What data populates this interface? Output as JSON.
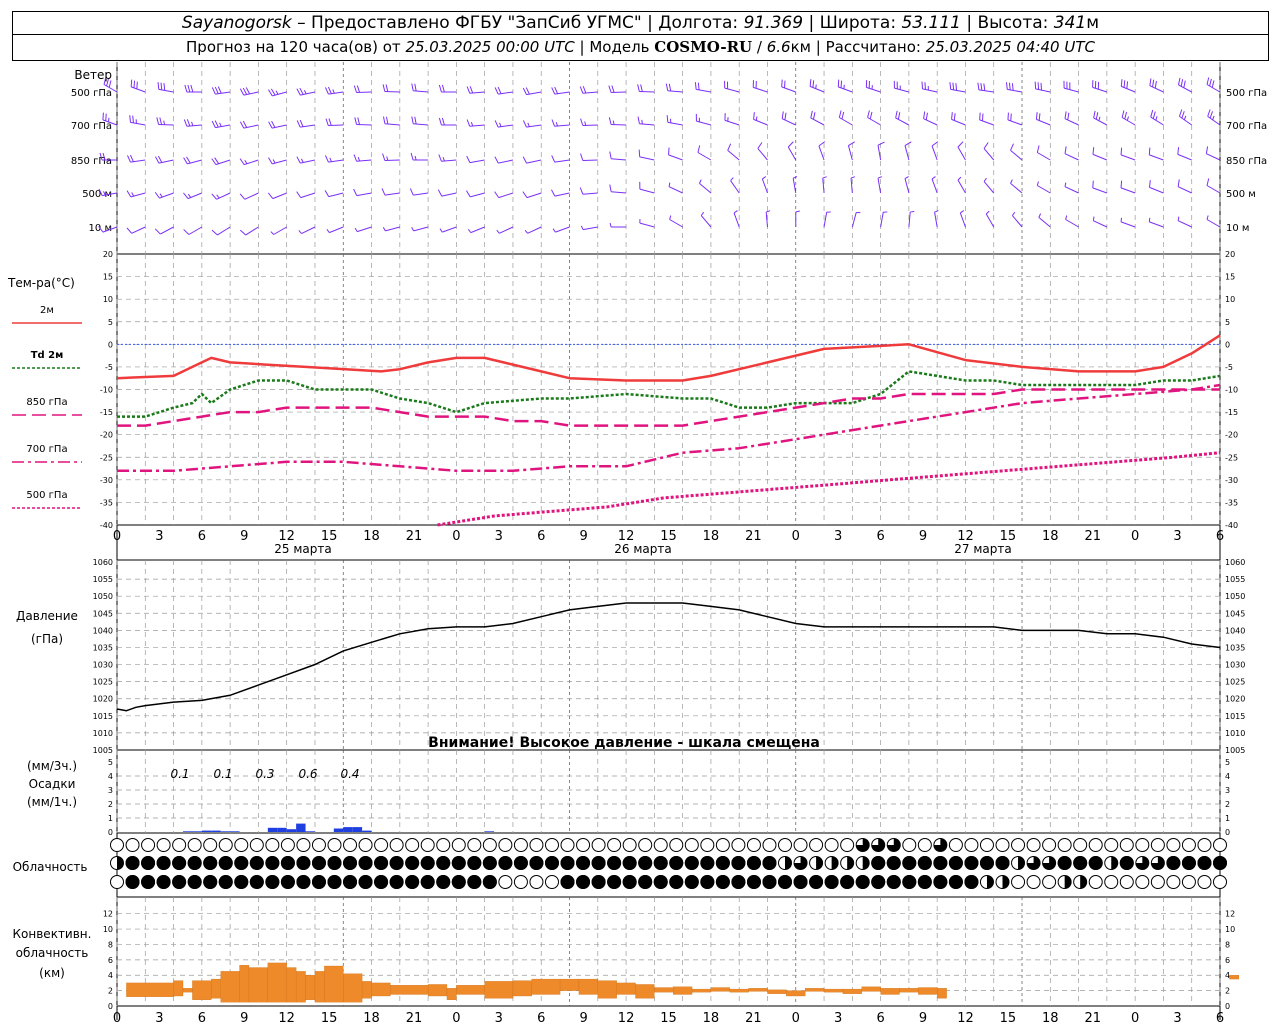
{
  "header": {
    "station": "Sayanogorsk",
    "dash": "–",
    "provider": "Предоставлено ФГБУ \"ЗапСиб УГМС\"",
    "lon_label": "Долгота:",
    "lon": "91.369",
    "lat_label": "Широта:",
    "lat": "53.111",
    "alt_label": "Высота:",
    "alt": "341",
    "alt_unit": "м",
    "fc_prefix": "Прогноз на 120 часа(ов) от",
    "fc_start": "25.03.2025 00:00 UTC",
    "model_label": "Модель",
    "model": "COSMO-RU",
    "model_res": "6.6",
    "model_res_unit": "км",
    "calc_label": "Рассчитано:",
    "calc_time": "25.03.2025 04:40 UTC"
  },
  "colors": {
    "wind": "#7b2ff7",
    "t2m": "#ef3b3b",
    "td2m": "#1a7a1a",
    "t850": "#e0147f",
    "t700": "#e0147f",
    "t500": "#e0147f",
    "zero": "#3355ff",
    "pressure": "#000000",
    "precip": "#1f3fe0",
    "convective": "#ef8a2a",
    "grid": "#9a9a9a"
  },
  "time_axis": {
    "tick_labels": [
      "0",
      "3",
      "6",
      "9",
      "12",
      "15",
      "18",
      "21",
      "0",
      "3",
      "6",
      "9",
      "12",
      "15",
      "18",
      "21",
      "0",
      "3",
      "6",
      "9",
      "12",
      "15",
      "18",
      "21",
      "0",
      "3",
      "6"
    ],
    "day_labels": [
      "25 марта",
      "26 марта",
      "27 марта"
    ]
  },
  "wind": {
    "title": "Ветер",
    "levels": [
      "500 гПа",
      "700 гПа",
      "850 гПа",
      "500 м",
      "10 м"
    ]
  },
  "chart_data": [
    {
      "type": "line",
      "title": "Тем-ра(°C)",
      "x_unit": "hours from 25.03.2025 00:00 UTC",
      "ylim": [
        -40,
        20
      ],
      "yticks": [
        "20",
        "15",
        "10",
        "5",
        "0",
        "-5",
        "-10",
        "-15",
        "-20",
        "-25",
        "-30",
        "-35",
        "-40"
      ],
      "series": [
        {
          "name": "2м",
          "x": [
            0,
            6,
            8,
            10,
            12,
            16,
            20,
            28,
            30,
            33,
            36,
            39,
            45,
            48,
            54,
            60,
            63,
            69,
            75,
            84,
            90,
            96,
            102,
            105,
            108,
            111,
            114,
            117
          ],
          "values": [
            -7.5,
            -7,
            -5,
            -3,
            -4,
            -4.5,
            -5,
            -6,
            -5.5,
            -4,
            -3,
            -3,
            -6,
            -7.5,
            -8,
            -8,
            -7,
            -4,
            -1,
            0,
            -3.5,
            -5,
            -6,
            -6,
            -6,
            -5,
            -2,
            2
          ]
        },
        {
          "name": "Td 2м",
          "x": [
            0,
            3,
            6,
            8,
            9,
            10,
            12,
            15,
            18,
            21,
            24,
            27,
            30,
            33,
            36,
            39,
            45,
            48,
            54,
            60,
            63,
            66,
            69,
            72,
            75,
            78,
            81,
            84,
            87,
            90,
            93,
            96,
            99,
            102,
            105,
            108,
            111,
            114,
            117
          ],
          "values": [
            -16,
            -16,
            -14,
            -13,
            -11,
            -13,
            -10,
            -8,
            -8,
            -10,
            -10,
            -10,
            -12,
            -13,
            -15,
            -13,
            -12,
            -12,
            -11,
            -12,
            -12,
            -14,
            -14,
            -13,
            -13,
            -13,
            -11,
            -6,
            -7,
            -8,
            -8,
            -9,
            -9,
            -9,
            -9,
            -9,
            -8,
            -8,
            -7
          ]
        },
        {
          "name": "850 гПа",
          "x": [
            0,
            3,
            6,
            9,
            12,
            15,
            18,
            21,
            24,
            27,
            30,
            33,
            36,
            39,
            42,
            45,
            48,
            51,
            54,
            57,
            60,
            63,
            66,
            69,
            72,
            75,
            78,
            81,
            84,
            87,
            90,
            93,
            96,
            99,
            102,
            105,
            108,
            111,
            114,
            117
          ],
          "values": [
            -18,
            -18,
            -17,
            -16,
            -15,
            -15,
            -14,
            -14,
            -14,
            -14,
            -15,
            -16,
            -16,
            -16,
            -17,
            -17,
            -18,
            -18,
            -18,
            -18,
            -18,
            -17,
            -16,
            -15,
            -14,
            -13,
            -12,
            -12,
            -11,
            -11,
            -11,
            -11,
            -10,
            -10,
            -10,
            -10,
            -10,
            -10,
            -10,
            -10
          ]
        },
        {
          "name": "700 гПа",
          "x": [
            0,
            6,
            12,
            18,
            24,
            30,
            36,
            42,
            48,
            54,
            60,
            66,
            72,
            78,
            84,
            90,
            96,
            102,
            108,
            114,
            117
          ],
          "values": [
            -28,
            -28,
            -27,
            -26,
            -26,
            -27,
            -28,
            -28,
            -27,
            -27,
            -24,
            -23,
            -21,
            -19,
            -17,
            -15,
            -13,
            -12,
            -11,
            -10,
            -9
          ]
        },
        {
          "name": "500 гПа",
          "x": [
            34,
            40,
            46,
            52,
            58,
            64,
            70,
            76,
            82,
            88,
            94,
            100,
            106,
            112,
            117
          ],
          "values": [
            -40,
            -38,
            -37,
            -36,
            -34,
            -33,
            -32,
            -31,
            -30,
            -29,
            -28,
            -27,
            -26,
            -25,
            -24
          ]
        }
      ]
    },
    {
      "type": "line",
      "title": "Давление",
      "unit": "(гПа)",
      "note": "Внимание! Высокое давление - шкала смещена",
      "ylim": [
        1005,
        1060
      ],
      "yticks": [
        "1060",
        "1055",
        "1050",
        "1045",
        "1040",
        "1035",
        "1030",
        "1025",
        "1020",
        "1015",
        "1010",
        "1005"
      ],
      "series": [
        {
          "name": "Давление",
          "x": [
            0,
            1,
            2,
            3,
            6,
            9,
            12,
            15,
            18,
            21,
            24,
            27,
            30,
            33,
            36,
            39,
            42,
            45,
            48,
            51,
            54,
            57,
            60,
            63,
            66,
            69,
            72,
            75,
            78,
            81,
            84,
            87,
            90,
            93,
            96,
            99,
            102,
            105,
            108,
            111,
            114,
            117
          ],
          "values": [
            1017,
            1016.5,
            1017.5,
            1018,
            1019,
            1019.5,
            1021,
            1024,
            1027,
            1030,
            1034,
            1036.5,
            1039,
            1040.5,
            1041,
            1041,
            1042,
            1044,
            1046,
            1047,
            1048,
            1048,
            1048,
            1047,
            1046,
            1044,
            1042,
            1041,
            1041,
            1041,
            1041,
            1041,
            1041,
            1041,
            1040,
            1040,
            1040,
            1039,
            1039,
            1038,
            1036,
            1035
          ]
        }
      ]
    },
    {
      "type": "bar",
      "title": "Осадки",
      "unit_3h": "(мм/3ч.)",
      "unit_1h": "(мм/1ч.)",
      "ylim": [
        0,
        5
      ],
      "yticks": [
        "5",
        "4",
        "3",
        "2",
        "1",
        "0"
      ],
      "sum_labels": [
        "0.1",
        "0.1",
        "0.3",
        "0.6",
        "0.4"
      ],
      "x": [
        6,
        7,
        8,
        9,
        10,
        11,
        12,
        13,
        14,
        15,
        16,
        17,
        18,
        19,
        20,
        21,
        22,
        23,
        24,
        25,
        26,
        27,
        28,
        29,
        30,
        31,
        32,
        33,
        34,
        35,
        36,
        37,
        38,
        39,
        40
      ],
      "values": [
        0,
        0,
        0.05,
        0.05,
        0.1,
        0.1,
        0.05,
        0.05,
        0,
        0,
        0,
        0.3,
        0.3,
        0.2,
        0.6,
        0.05,
        0,
        0,
        0.25,
        0.35,
        0.35,
        0.1,
        0,
        0,
        0,
        0,
        0,
        0,
        0,
        0,
        0,
        0,
        0,
        0,
        0.05
      ]
    },
    {
      "type": "table",
      "title": "Облачность",
      "rows": [
        "upper",
        "middle",
        "lower"
      ],
      "legend": "0 = clear, 1 = 1/4, 2 = 1/2, 3 = 3/4, 4 = overcast",
      "upper": "000000000000000000000000000000000000000000000000000000000000000000000000000000000003333330003000000000000000000000000000000000",
      "middle": "244444444444444444444444444444444444444444444444444444444444444444444444444444444444442333232322244444444444444444442333344444422443333444424444",
      "lower": "044444444444444444444444444444444444444444444444000002044444444444444444444444444444444444444444444444444444420220000002222000000000000000000"
    },
    {
      "type": "bar",
      "title": "Конвективн. облачность",
      "unit": "(км)",
      "ylim": [
        0,
        14
      ],
      "yticks": [
        "12",
        "10",
        "8",
        "6",
        "4",
        "2",
        "0"
      ],
      "bars": [
        {
          "x0": 1,
          "x1": 6,
          "lo": 1.2,
          "hi": 3.0
        },
        {
          "x0": 6,
          "x1": 7,
          "lo": 1.3,
          "hi": 3.3
        },
        {
          "x0": 7,
          "x1": 8,
          "lo": 1.8,
          "hi": 2.3
        },
        {
          "x0": 8,
          "x1": 10,
          "lo": 0.8,
          "hi": 3.3
        },
        {
          "x0": 10,
          "x1": 11,
          "lo": 1.0,
          "hi": 3.5
        },
        {
          "x0": 11,
          "x1": 13,
          "lo": 0.5,
          "hi": 4.5
        },
        {
          "x0": 13,
          "x1": 14,
          "lo": 0.5,
          "hi": 5.3
        },
        {
          "x0": 14,
          "x1": 16,
          "lo": 0.5,
          "hi": 5.0
        },
        {
          "x0": 16,
          "x1": 18,
          "lo": 0.5,
          "hi": 5.6
        },
        {
          "x0": 18,
          "x1": 19,
          "lo": 0.5,
          "hi": 5.0
        },
        {
          "x0": 19,
          "x1": 20,
          "lo": 0.5,
          "hi": 4.5
        },
        {
          "x0": 20,
          "x1": 21,
          "lo": 0.8,
          "hi": 4.0
        },
        {
          "x0": 21,
          "x1": 22,
          "lo": 0.5,
          "hi": 4.5
        },
        {
          "x0": 22,
          "x1": 24,
          "lo": 0.5,
          "hi": 5.2
        },
        {
          "x0": 24,
          "x1": 26,
          "lo": 0.5,
          "hi": 4.2
        },
        {
          "x0": 26,
          "x1": 27,
          "lo": 1.0,
          "hi": 3.2
        },
        {
          "x0": 27,
          "x1": 29,
          "lo": 1.3,
          "hi": 3.0
        },
        {
          "x0": 29,
          "x1": 33,
          "lo": 1.5,
          "hi": 2.7
        },
        {
          "x0": 33,
          "x1": 35,
          "lo": 1.3,
          "hi": 2.8
        },
        {
          "x0": 35,
          "x1": 36,
          "lo": 0.8,
          "hi": 2.3
        },
        {
          "x0": 36,
          "x1": 39,
          "lo": 1.5,
          "hi": 2.7
        },
        {
          "x0": 39,
          "x1": 42,
          "lo": 1.0,
          "hi": 3.2
        },
        {
          "x0": 42,
          "x1": 44,
          "lo": 1.3,
          "hi": 3.3
        },
        {
          "x0": 44,
          "x1": 47,
          "lo": 1.5,
          "hi": 3.5
        },
        {
          "x0": 47,
          "x1": 49,
          "lo": 2.0,
          "hi": 3.5
        },
        {
          "x0": 49,
          "x1": 51,
          "lo": 1.5,
          "hi": 3.5
        },
        {
          "x0": 51,
          "x1": 53,
          "lo": 1.0,
          "hi": 3.3
        },
        {
          "x0": 53,
          "x1": 55,
          "lo": 1.5,
          "hi": 3.0
        },
        {
          "x0": 55,
          "x1": 57,
          "lo": 1.0,
          "hi": 2.8
        },
        {
          "x0": 57,
          "x1": 59,
          "lo": 1.8,
          "hi": 2.4
        },
        {
          "x0": 59,
          "x1": 61,
          "lo": 1.5,
          "hi": 2.5
        },
        {
          "x0": 61,
          "x1": 63,
          "lo": 1.8,
          "hi": 2.2
        },
        {
          "x0": 63,
          "x1": 65,
          "lo": 1.9,
          "hi": 2.4
        },
        {
          "x0": 65,
          "x1": 67,
          "lo": 1.8,
          "hi": 2.2
        },
        {
          "x0": 67,
          "x1": 69,
          "lo": 1.9,
          "hi": 2.3
        },
        {
          "x0": 69,
          "x1": 71,
          "lo": 1.6,
          "hi": 2.1
        },
        {
          "x0": 71,
          "x1": 73,
          "lo": 1.3,
          "hi": 2.0
        },
        {
          "x0": 73,
          "x1": 75,
          "lo": 1.9,
          "hi": 2.3
        },
        {
          "x0": 75,
          "x1": 77,
          "lo": 1.8,
          "hi": 2.2
        },
        {
          "x0": 77,
          "x1": 79,
          "lo": 1.6,
          "hi": 2.2
        },
        {
          "x0": 79,
          "x1": 81,
          "lo": 1.9,
          "hi": 2.5
        },
        {
          "x0": 81,
          "x1": 83,
          "lo": 1.5,
          "hi": 2.3
        },
        {
          "x0": 83,
          "x1": 85,
          "lo": 1.8,
          "hi": 2.3
        },
        {
          "x0": 85,
          "x1": 87,
          "lo": 1.5,
          "hi": 2.4
        },
        {
          "x0": 87,
          "x1": 88,
          "lo": 1.0,
          "hi": 2.3
        },
        {
          "x0": 118,
          "x1": 119,
          "lo": 3.5,
          "hi": 4.0
        }
      ]
    }
  ]
}
